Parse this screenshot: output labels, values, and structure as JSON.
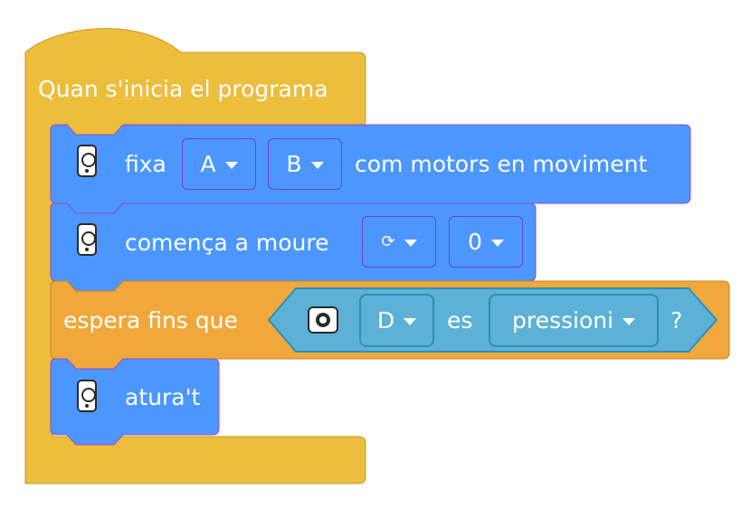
{
  "colors": {
    "event": "#edbd3c",
    "motor": "#4c97ff",
    "control": "#f1a83a",
    "sensor": "#5cb1d6",
    "outline": "#9a49c7"
  },
  "hat": {
    "label": "Quan s'inicia el programa"
  },
  "motors": {
    "label_prefix": "fixa",
    "port_a": "A",
    "port_b": "B",
    "label_suffix": "com motors en moviment"
  },
  "move": {
    "label": "comença a moure",
    "direction_symbol": "⟳",
    "amount": "0"
  },
  "wait": {
    "label": "espera fins que",
    "port": "D",
    "connector": "es",
    "state": "pressioni",
    "question_mark": "?"
  },
  "stop": {
    "label": "atura't"
  },
  "icons": {
    "hub": "motor-hub-icon",
    "sensor": "force-sensor-icon"
  }
}
